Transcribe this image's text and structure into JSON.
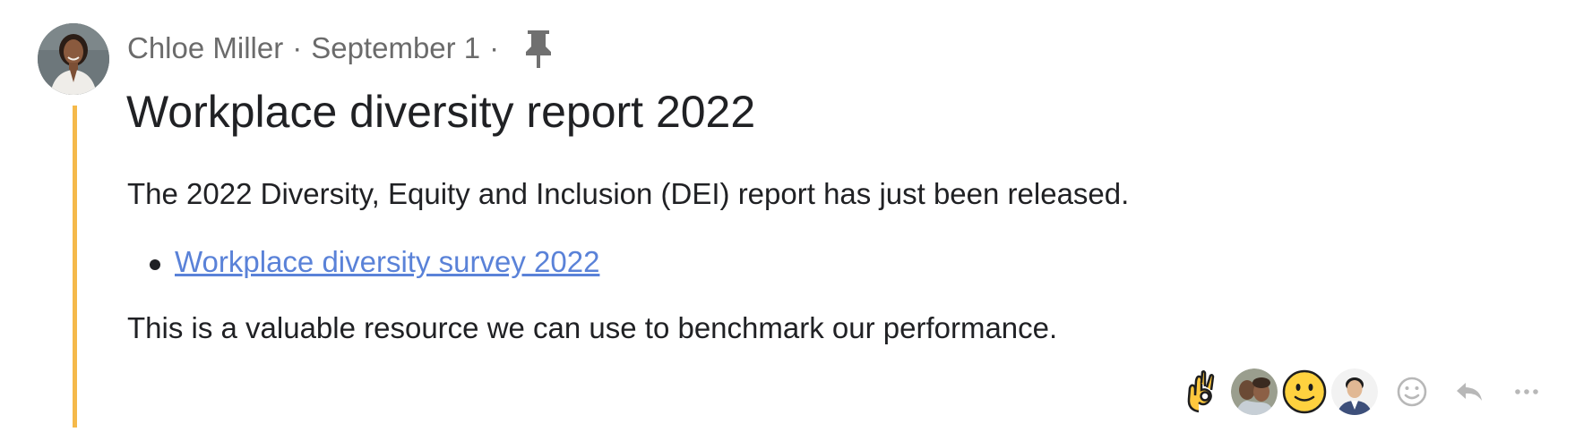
{
  "post": {
    "author": "Chloe Miller",
    "separator": "·",
    "date": "September 1",
    "title": "Workplace diversity report 2022",
    "paragraph1": "The 2022 Diversity, Equity and Inclusion (DEI) report has just been released.",
    "link_text": "Workplace diversity survey 2022",
    "paragraph2": "This is a valuable resource we can use to benchmark our performance."
  },
  "icons": {
    "pin": "pin-icon",
    "add_reaction": "smiley-outline-icon",
    "reply": "reply-icon",
    "more": "more-horizontal-icon"
  },
  "reactions": [
    {
      "type": "emoji",
      "icon": "ok-hand-emoji"
    },
    {
      "type": "avatar",
      "icon": "user-avatar"
    },
    {
      "type": "emoji",
      "icon": "slightly-smiling-face-emoji"
    },
    {
      "type": "avatar",
      "icon": "user-avatar"
    }
  ],
  "colors": {
    "thread_line": "#f5b94a",
    "link": "#5a82d8",
    "meta_text": "#6b6b6b",
    "body_text": "#202124",
    "action_icon": "#b8b8b8"
  }
}
